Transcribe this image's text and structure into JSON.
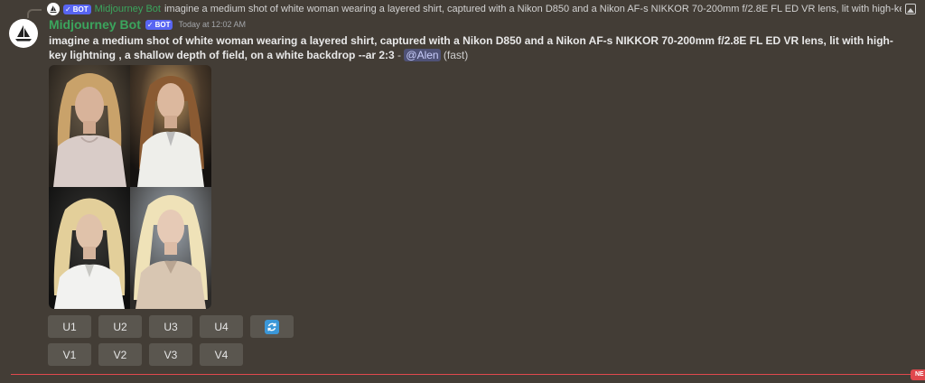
{
  "reply": {
    "bot_tag": "BOT",
    "author": "Midjourney Bot",
    "text": "imagine a medium shot of white woman wearing a layered shirt, captured with a Nikon D850 and a Nikon AF-s NIKKOR 70-200mm f/2.8E FL ED VR lens, lit with high-key l"
  },
  "message": {
    "author": "Midjourney Bot",
    "bot_tag": "BOT",
    "timestamp": "Today at 12:02 AM",
    "prompt": "imagine a medium shot of white woman wearing a layered shirt, captured with a Nikon D850 and a Nikon AF-s NIKKOR 70-200mm f/2.8E FL ED VR lens, lit with high-key lightning , a shallow depth of field, on a white backdrop --ar 2:3",
    "separator": " - ",
    "mention": "@Alen",
    "speed": " (fast)"
  },
  "buttons": {
    "upscale": [
      "U1",
      "U2",
      "U3",
      "U4"
    ],
    "variation": [
      "V1",
      "V2",
      "V3",
      "V4"
    ],
    "reroll_icon": "refresh-icon"
  },
  "new_marker": "NE",
  "colors": {
    "background": "#433d36",
    "author": "#3ba55d",
    "bot_tag": "#5865f2",
    "button": "#5a564f",
    "reroll": "#3b97d8",
    "new_line": "#e0484d"
  }
}
